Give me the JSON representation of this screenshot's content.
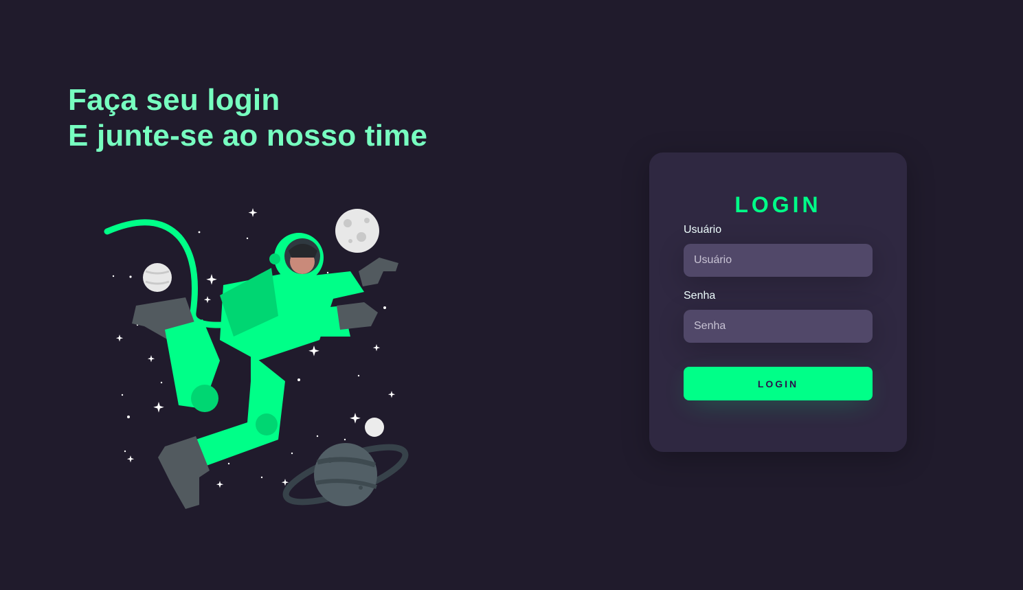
{
  "hero": {
    "line1": "Faça seu login",
    "line2": "E junte-se ao nosso time",
    "illustration": "astronaut-illustration"
  },
  "login_card": {
    "title": "LOGIN",
    "username_label": "Usuário",
    "username_placeholder": "Usuário",
    "password_label": "Senha",
    "password_placeholder": "Senha",
    "submit_label": "LOGIN"
  },
  "colors": {
    "background": "#201b2c",
    "card": "#2f2841",
    "input": "#514869",
    "accent": "#00ff88",
    "headline": "#77ffc0"
  }
}
